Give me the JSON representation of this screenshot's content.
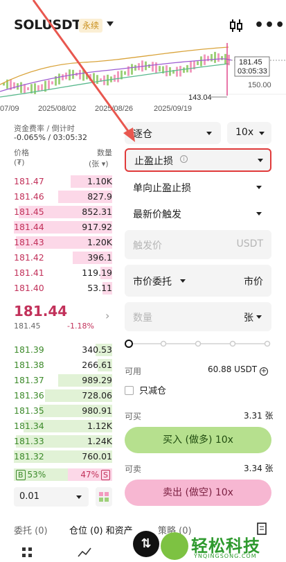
{
  "header": {
    "symbol": "SOLUSDT",
    "badge": "永续",
    "more": "•••"
  },
  "chart": {
    "price_tag": "181.45",
    "countdown": "03:05:33",
    "level_150": "150.00",
    "low_label": "143.04",
    "dates": [
      "07/09",
      "2025/08/02",
      "2025/08/26",
      "2025/09/19"
    ]
  },
  "funding": {
    "label": "资金费率 / 倒计时",
    "value": "-0.065% / 03:05:32"
  },
  "book": {
    "price_header": "价格",
    "price_unit": "(₮)",
    "qty_header": "数量",
    "qty_unit": "(张 ▾)",
    "asks": [
      {
        "price": "181.47",
        "qty": "1.10K",
        "depth": 0.42
      },
      {
        "price": "181.46",
        "qty": "827.9",
        "depth": 0.55
      },
      {
        "price": "181.45",
        "qty": "852.31",
        "depth": 0.95
      },
      {
        "price": "181.44",
        "qty": "917.92",
        "depth": 1.0
      },
      {
        "price": "181.43",
        "qty": "1.20K",
        "depth": 0.98
      },
      {
        "price": "181.42",
        "qty": "396.1",
        "depth": 0.4
      },
      {
        "price": "181.41",
        "qty": "119.19",
        "depth": 0.12
      },
      {
        "price": "181.40",
        "qty": "53.11",
        "depth": 0.1
      }
    ],
    "mid_price": "181.44",
    "mark_price": "181.45",
    "change": "-1.18%",
    "bids": [
      {
        "price": "181.39",
        "qty": "340.53",
        "depth": 0.17
      },
      {
        "price": "181.38",
        "qty": "266.61",
        "depth": 0.15
      },
      {
        "price": "181.37",
        "qty": "989.29",
        "depth": 0.55
      },
      {
        "price": "181.36",
        "qty": "728.06",
        "depth": 0.68
      },
      {
        "price": "181.35",
        "qty": "980.91",
        "depth": 0.74
      },
      {
        "price": "181.34",
        "qty": "1.12K",
        "depth": 0.9
      },
      {
        "price": "181.33",
        "qty": "1.24K",
        "depth": 0.98
      },
      {
        "price": "181.32",
        "qty": "760.01",
        "depth": 1.0
      }
    ],
    "buy_ratio_tag": "B",
    "buy_ratio": "53%",
    "sell_ratio": "47%",
    "sell_ratio_tag": "S",
    "precision": "0.01"
  },
  "order": {
    "margin_mode": "逐仓",
    "leverage": "10x",
    "tp_sl": "止盈止损",
    "direction_tpsl": "单向止盈止损",
    "trigger_type": "最新价触发",
    "trigger_placeholder": "触发价",
    "trigger_unit": "USDT",
    "order_type": "市价委托",
    "order_price": "市价",
    "qty_placeholder": "数量",
    "qty_unit": "张",
    "slider_percent": 0,
    "available_label": "可用",
    "available_value": "60.88 USDT",
    "reduce_only": "只减仓",
    "can_buy_label": "可买",
    "can_buy_value": "3.31 张",
    "buy_button": "买入 (做多) 10x",
    "can_sell_label": "可卖",
    "can_sell_value": "3.34 张",
    "sell_button": "卖出 (做空) 10x"
  },
  "tabs": {
    "orders": "委托 (0)",
    "positions": "仓位 (0) 和资产",
    "strategy": "策略 (0)"
  },
  "watermark": {
    "brand": "轻松科技",
    "url": "YNQINGSONG.COM"
  },
  "colors": {
    "ask": "#c2315a",
    "bid": "#3c8a2a",
    "highlight": "#e03a3a",
    "arrow": "#e8574f"
  }
}
